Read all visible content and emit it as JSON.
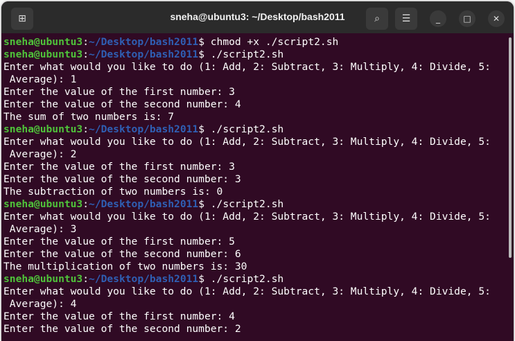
{
  "window": {
    "title": "sneha@ubuntu3: ~/Desktop/bash2011"
  },
  "icons": {
    "new_tab": "new-tab-icon",
    "search": "search-icon",
    "menu": "hamburger-icon",
    "minimize": "minimize-icon",
    "maximize": "maximize-icon",
    "close": "close-icon"
  },
  "colors": {
    "background": "#300a24",
    "user": "#4fc33a",
    "path": "#2f5fb4"
  },
  "prompt": {
    "user": "sneha@ubuntu3",
    "path": "~/Desktop/bash2011"
  },
  "lines": [
    {
      "type": "prompt",
      "cmd": "chmod +x ./script2.sh"
    },
    {
      "type": "prompt",
      "cmd": "./script2.sh"
    },
    {
      "type": "out",
      "text": "Enter what would you like to do (1: Add, 2: Subtract, 3: Multiply, 4: Divide, 5:"
    },
    {
      "type": "out",
      "text": " Average): 1"
    },
    {
      "type": "out",
      "text": "Enter the value of the first number: 3"
    },
    {
      "type": "out",
      "text": "Enter the value of the second number: 4"
    },
    {
      "type": "out",
      "text": "The sum of two numbers is: 7"
    },
    {
      "type": "prompt",
      "cmd": "./script2.sh"
    },
    {
      "type": "out",
      "text": "Enter what would you like to do (1: Add, 2: Subtract, 3: Multiply, 4: Divide, 5:"
    },
    {
      "type": "out",
      "text": " Average): 2"
    },
    {
      "type": "out",
      "text": "Enter the value of the first number: 3"
    },
    {
      "type": "out",
      "text": "Enter the value of the second number: 3"
    },
    {
      "type": "out",
      "text": "The subtraction of two numbers is: 0"
    },
    {
      "type": "prompt",
      "cmd": "./script2.sh"
    },
    {
      "type": "out",
      "text": "Enter what would you like to do (1: Add, 2: Subtract, 3: Multiply, 4: Divide, 5:"
    },
    {
      "type": "out",
      "text": " Average): 3"
    },
    {
      "type": "out",
      "text": "Enter the value of the first number: 5"
    },
    {
      "type": "out",
      "text": "Enter the value of the second number: 6"
    },
    {
      "type": "out",
      "text": "The multiplication of two numbers is: 30"
    },
    {
      "type": "prompt",
      "cmd": "./script2.sh"
    },
    {
      "type": "out",
      "text": "Enter what would you like to do (1: Add, 2: Subtract, 3: Multiply, 4: Divide, 5:"
    },
    {
      "type": "out",
      "text": " Average): 4"
    },
    {
      "type": "out",
      "text": "Enter the value of the first number: 4"
    },
    {
      "type": "out",
      "text": "Enter the value of the second number: 2"
    }
  ]
}
